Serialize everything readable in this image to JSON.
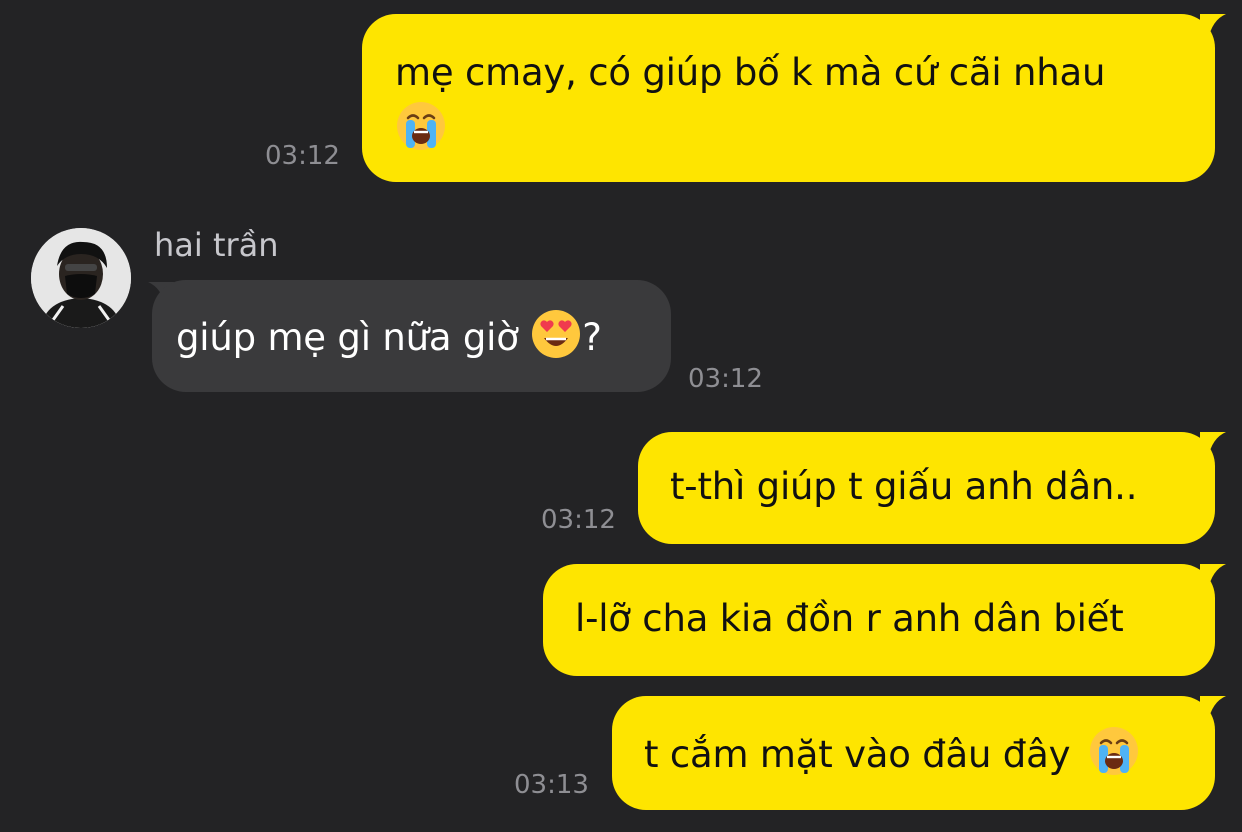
{
  "contact": {
    "name": "hai trần",
    "avatar_icon": "avatar-photo"
  },
  "messages": [
    {
      "direction": "out",
      "text": "mẹ cmay, có giúp bố k mà cứ cãi nhau",
      "emoji": "loudly-crying-face",
      "time": "03:12"
    },
    {
      "direction": "in",
      "text": "giúp mẹ gì nữa giờ",
      "emoji": "heart-eyes-face",
      "text_after": "?",
      "time": "03:12"
    },
    {
      "direction": "out",
      "text": "t-thì giúp t giấu anh dân..",
      "time": "03:12"
    },
    {
      "direction": "out",
      "text": "l-lỡ cha kia đồn r anh dân biết",
      "time": ""
    },
    {
      "direction": "out",
      "text": "t cắm mặt vào đâu đây",
      "emoji": "loudly-crying-face",
      "time": "03:13"
    }
  ],
  "colors": {
    "background": "#232325",
    "outgoing_bubble": "#FEE500",
    "incoming_bubble": "#3A3A3C",
    "timestamp": "#8E8E93"
  }
}
